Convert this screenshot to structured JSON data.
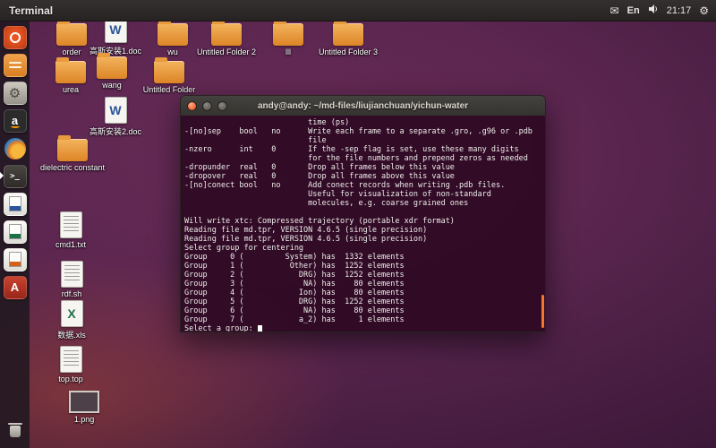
{
  "top_bar": {
    "app_name": "Terminal",
    "keyboard_indicator": "En",
    "clock": "21:17"
  },
  "launcher": {
    "amazon_glyph": "a",
    "terminal_glyph": "&gt;_",
    "software_center_glyph": "A"
  },
  "desktop": {
    "icon_glyphs": {
      "doc": "W",
      "xls": "X"
    },
    "icons": [
      {
        "label": "order"
      },
      {
        "label": "高斯安装1.doc"
      },
      {
        "label": "wu"
      },
      {
        "label": "Untitled Folder 2"
      },
      {
        "label": "lll"
      },
      {
        "label": "Untitled Folder 3"
      },
      {
        "label": "urea"
      },
      {
        "label": "wang"
      },
      {
        "label": "Untitled Folder"
      },
      {
        "label": "高斯安装2.doc"
      },
      {
        "label": "dielectric constant"
      },
      {
        "label": "cmd1.txt"
      },
      {
        "label": "rdf.sh"
      },
      {
        "label": "数据.xls"
      },
      {
        "label": "top.top"
      },
      {
        "label": "1.png"
      }
    ]
  },
  "terminal_window": {
    "title": "andy@andy: ~/md-files/liujianchuan/yichun-water",
    "body": "                           time (ps)\n-[no]sep    bool   no      Write each frame to a separate .gro, .g96 or .pdb\n                           file\n-nzero      int    0       If the -sep flag is set, use these many digits\n                           for the file numbers and prepend zeros as needed\n-dropunder  real   0       Drop all frames below this value\n-dropover   real   0       Drop all frames above this value\n-[no]conect bool   no      Add conect records when writing .pdb files.\n                           Useful for visualization of non-standard\n                           molecules, e.g. coarse grained ones\n\nWill write xtc: Compressed trajectory (portable xdr format)\nReading file md.tpr, VERSION 4.6.5 (single precision)\nReading file md.tpr, VERSION 4.6.5 (single precision)\nSelect group for centering\nGroup     0 (         System) has  1332 elements\nGroup     1 (          Other) has  1252 elements\nGroup     2 (            DRG) has  1252 elements\nGroup     3 (             NA) has    80 elements\nGroup     4 (            Ion) has    80 elements\nGroup     5 (            DRG) has  1252 elements\nGroup     6 (             NA) has    80 elements\nGroup     7 (            a_2) has     1 elements",
    "prompt": "Select a group: "
  }
}
